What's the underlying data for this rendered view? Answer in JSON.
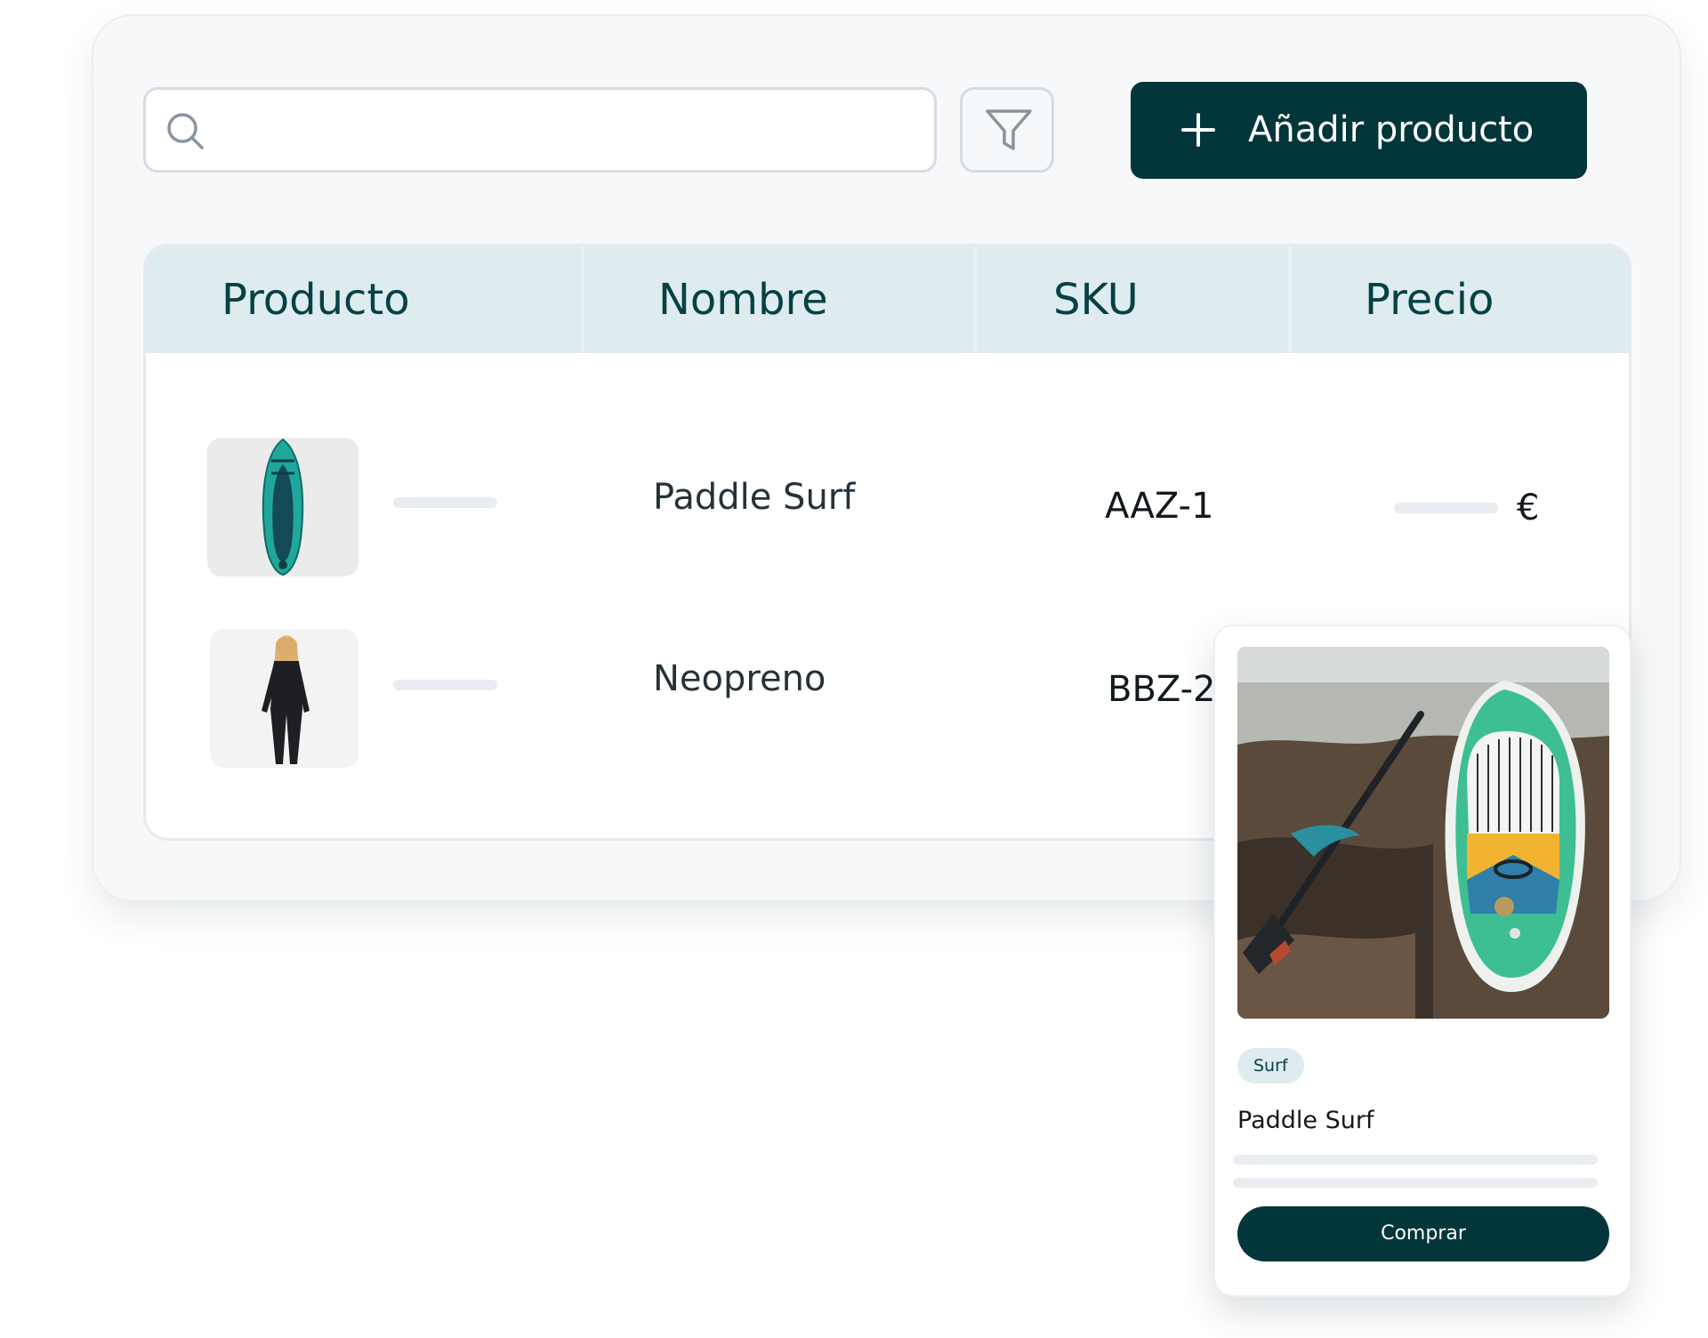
{
  "toolbar": {
    "search_placeholder": "",
    "search_icon": "search-icon",
    "filter_icon": "filter-icon",
    "add_icon": "plus-icon",
    "add_label": "Añadir producto"
  },
  "table": {
    "columns": [
      "Producto",
      "Nombre",
      "SKU",
      "Precio"
    ],
    "rows": [
      {
        "thumbnail": "paddle-board-image",
        "name": "Paddle Surf",
        "sku": "AAZ-1",
        "currency": "€"
      },
      {
        "thumbnail": "wetsuit-image",
        "name": "Neopreno",
        "sku": "BBZ-2"
      }
    ]
  },
  "card": {
    "image": "paddle-board-photo",
    "tag": "Surf",
    "title": "Paddle Surf",
    "button_label": "Comprar"
  },
  "colors": {
    "brand_dark": "#03363a",
    "header_bg": "#dfecef",
    "header_text": "#064145"
  }
}
